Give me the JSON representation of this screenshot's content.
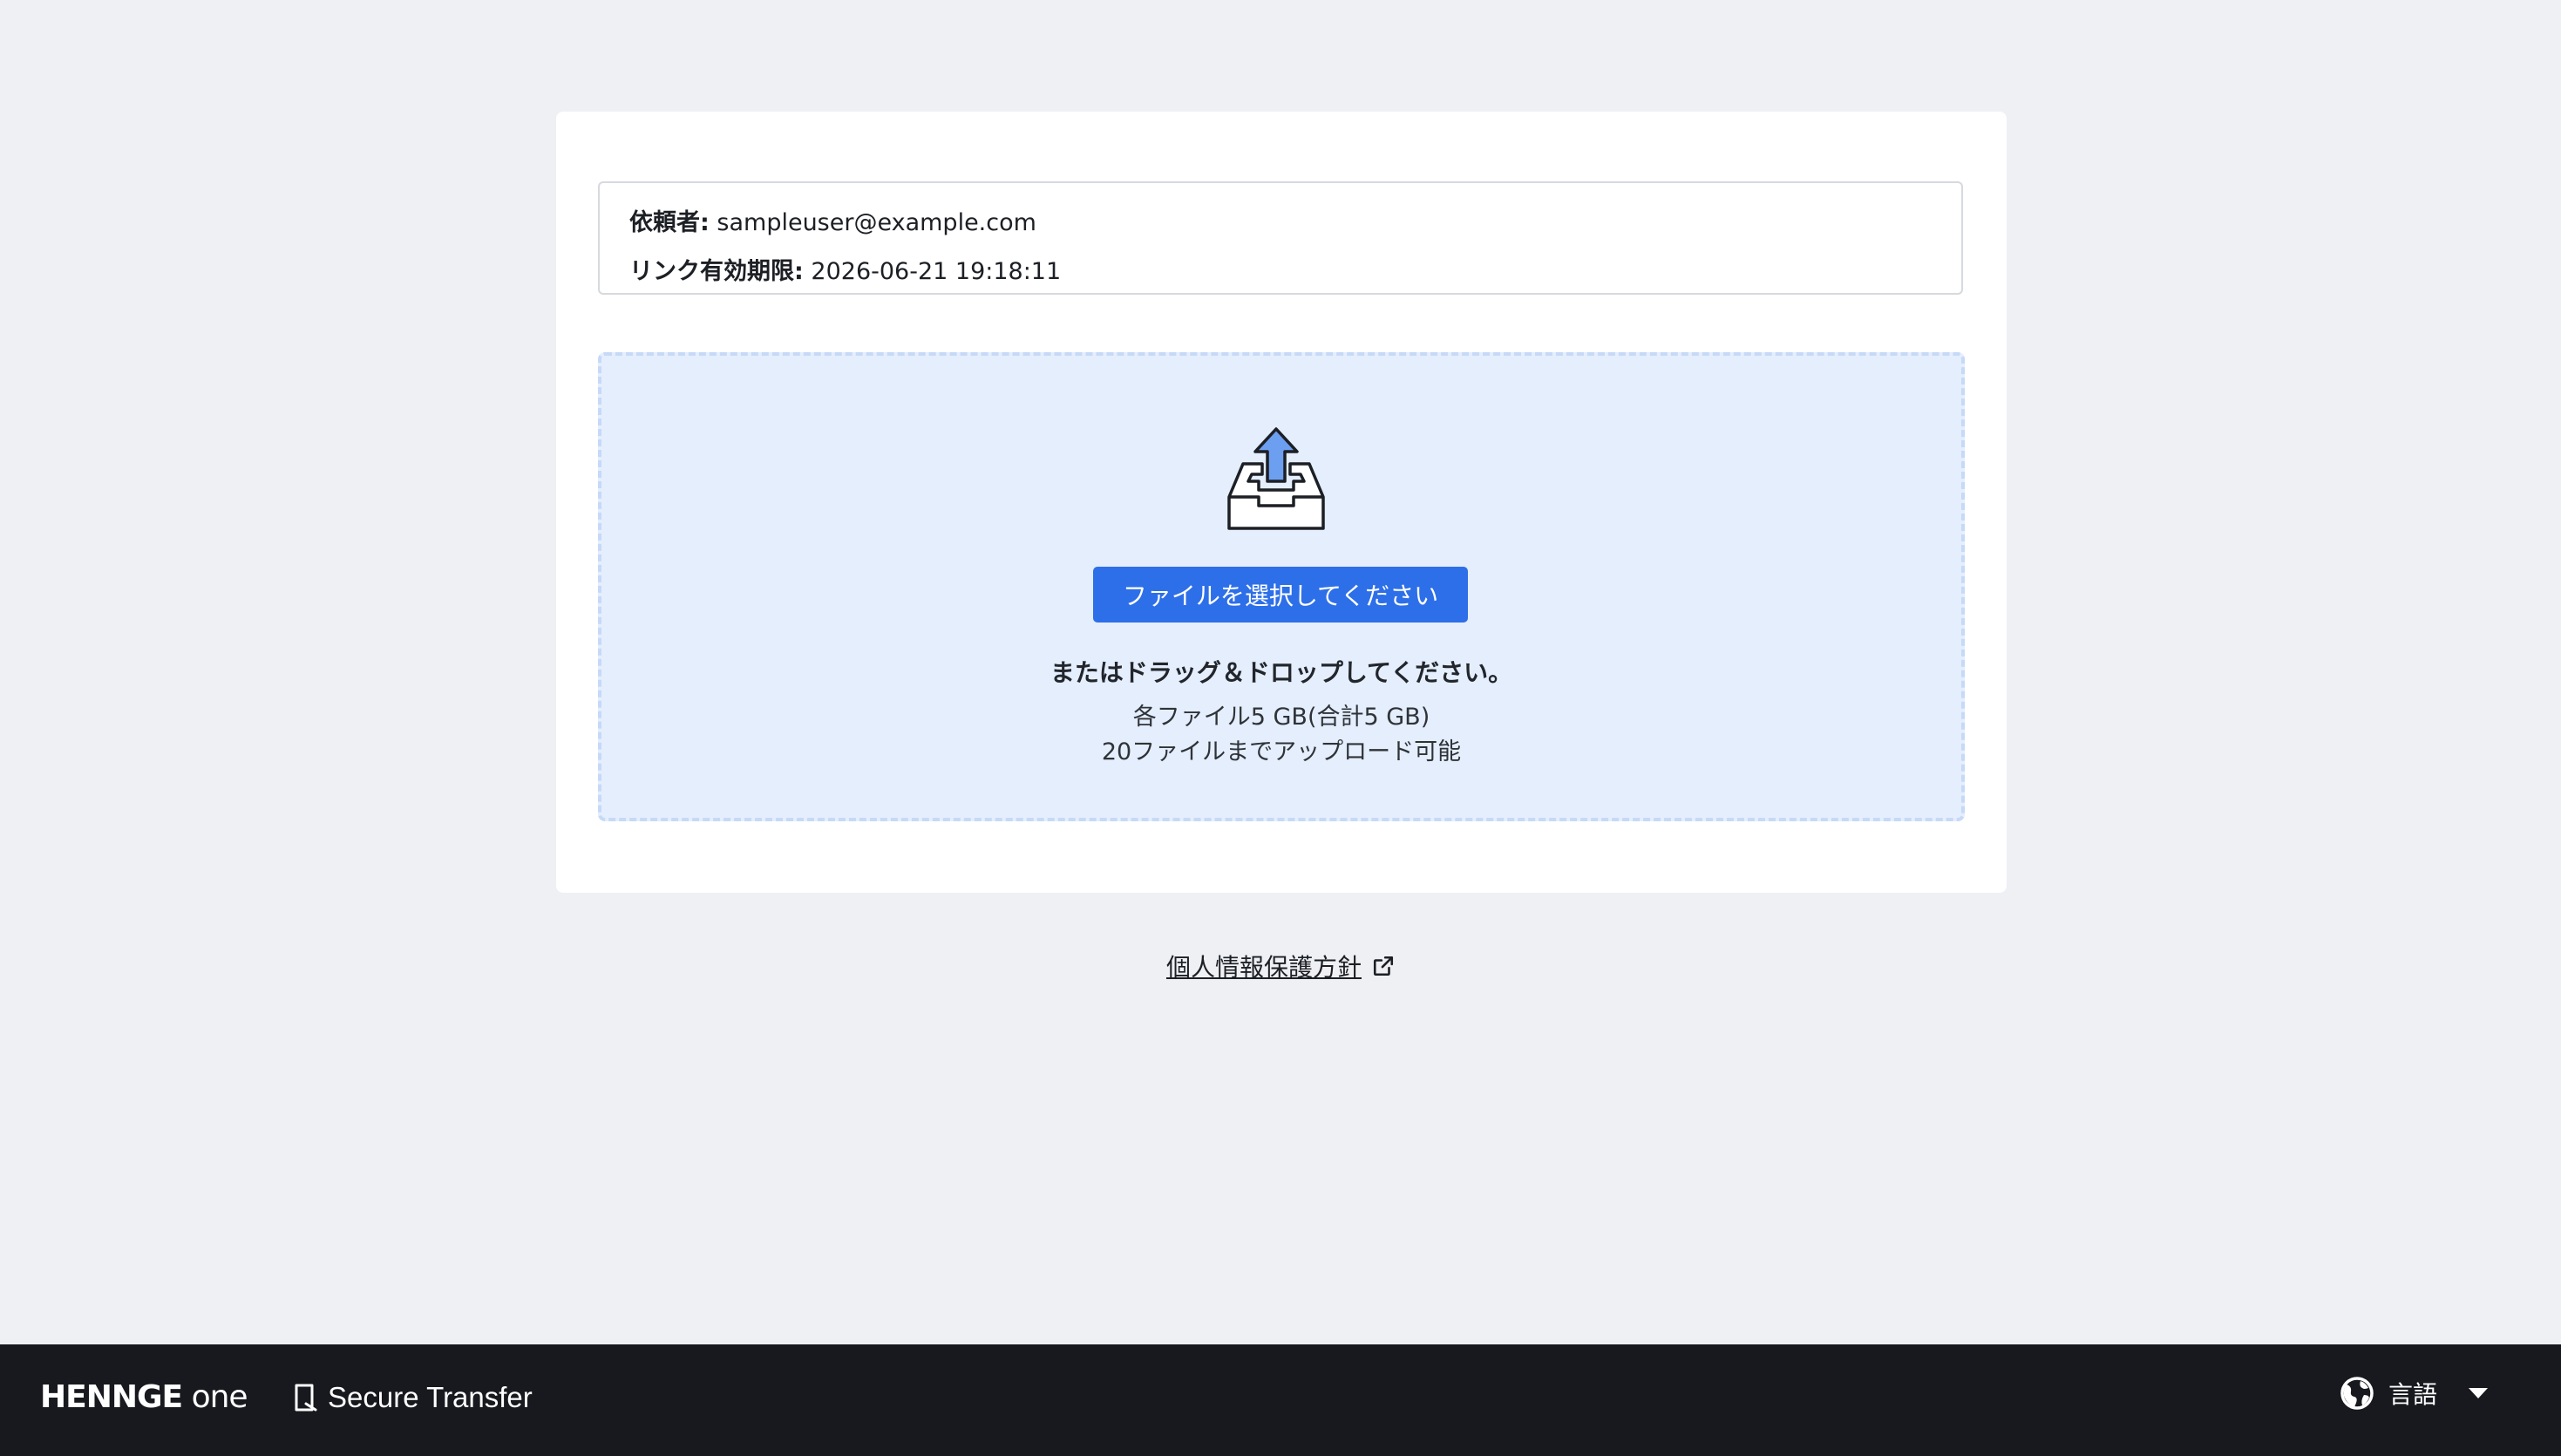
{
  "request": {
    "requester_label": "依頼者:",
    "requester_value": "sampleuser@example.com",
    "expiry_label": "リンク有効期限:",
    "expiry_value": "2026-06-21 19:18:11"
  },
  "upload": {
    "select_button_label": "ファイルを選択してください",
    "drag_text": "またはドラッグ＆ドロップしてください。",
    "limit_size": "各ファイル5 GB(合計5 GB)",
    "limit_count": "20ファイルまでアップロード可能",
    "icon": "upload-tray-icon",
    "accent_color": "#2d6fe8"
  },
  "privacy": {
    "label": "個人情報保護方針",
    "icon": "external-link-icon"
  },
  "footer": {
    "brand_part1": "HENNGE",
    "brand_part2": "one",
    "product_name": "Secure Transfer",
    "product_icon": "secure-transfer-icon",
    "language_label": "言語",
    "language_icon": "globe-icon",
    "dropdown_icon": "caret-down-icon"
  }
}
